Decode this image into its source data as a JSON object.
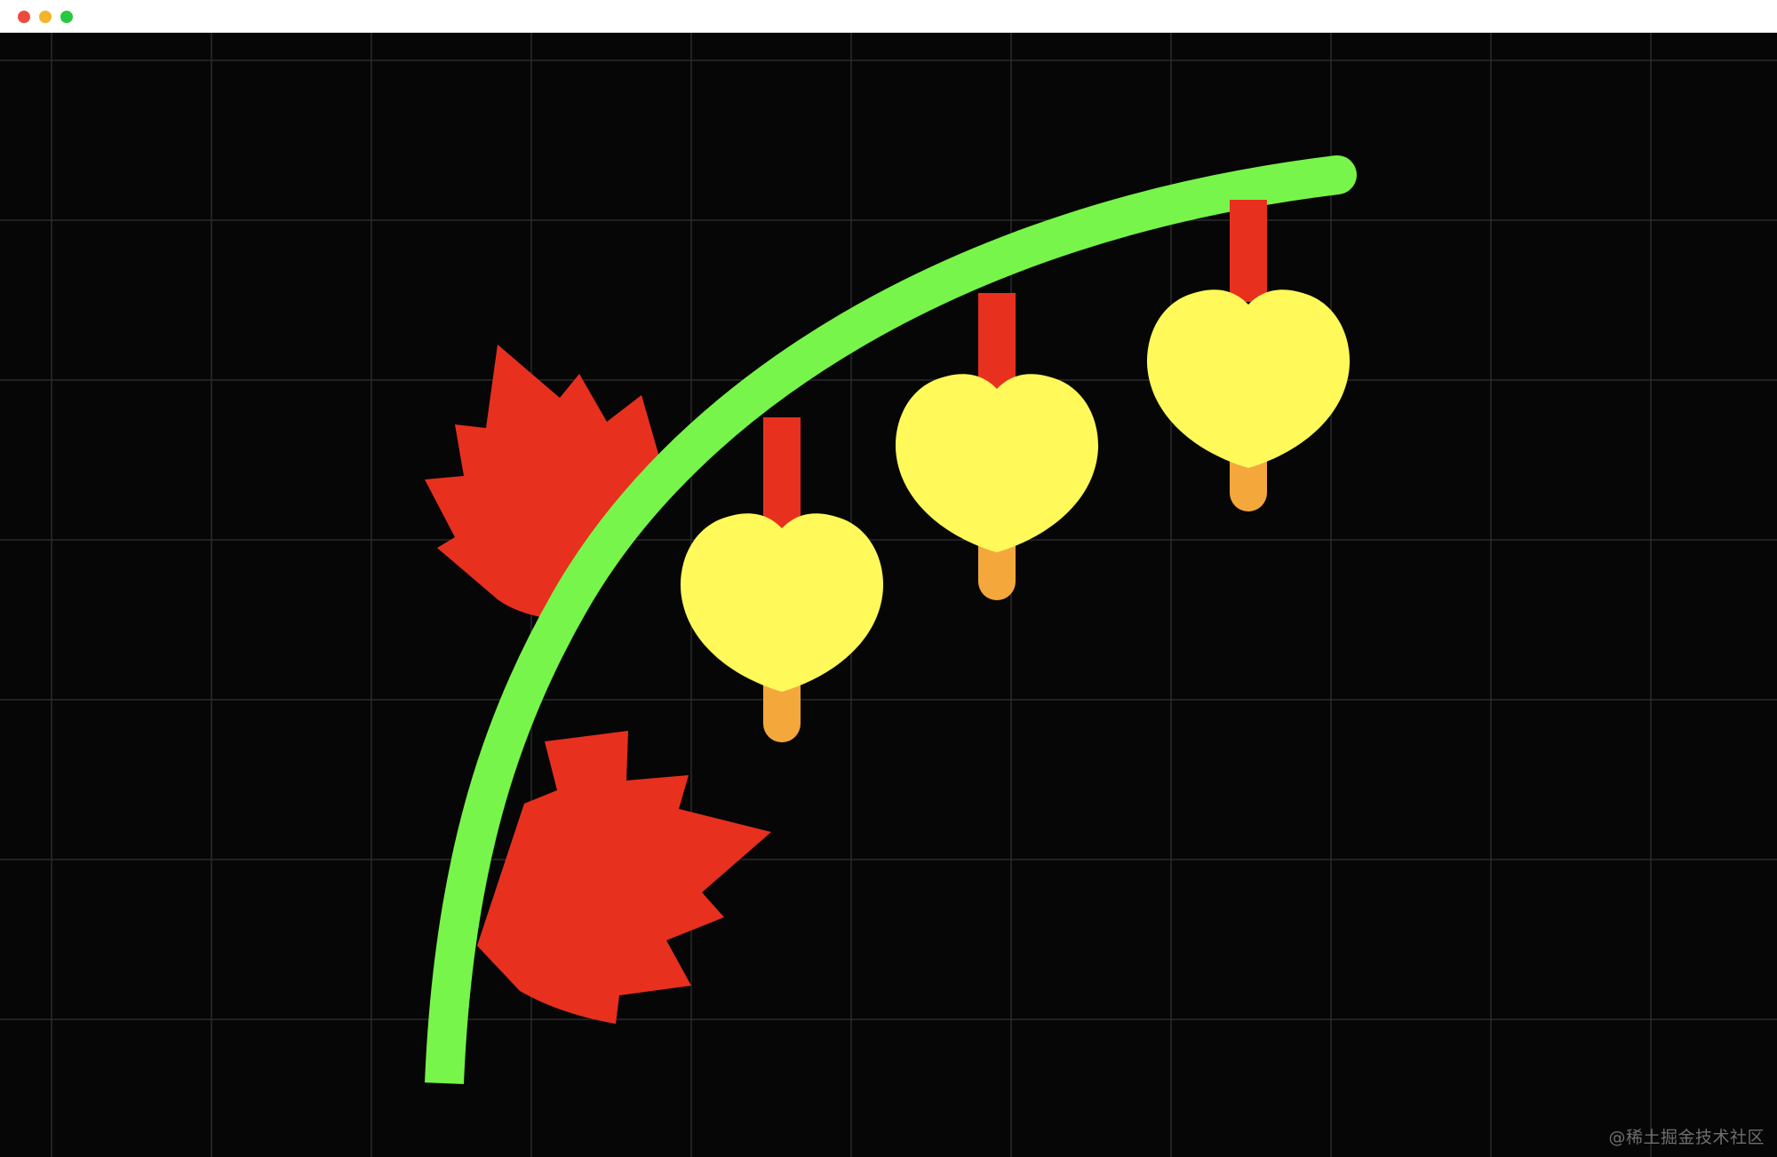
{
  "window": {
    "controls": [
      {
        "name": "close",
        "color": "#ec4c3f"
      },
      {
        "name": "minimize",
        "color": "#f3b42a"
      },
      {
        "name": "maximize",
        "color": "#29c840"
      }
    ]
  },
  "canvas": {
    "background": "#060606",
    "grid_color": "#2a2a2a",
    "illustration": {
      "stem_color": "#78f54a",
      "leaf_color": "#e8301f",
      "heart_color": "#fffa5a",
      "hanger_color": "#e8301f",
      "tip_color": "#f4a83c",
      "leaves": 2,
      "hearts": 3
    }
  },
  "watermark": {
    "text": "@稀土掘金技术社区"
  }
}
